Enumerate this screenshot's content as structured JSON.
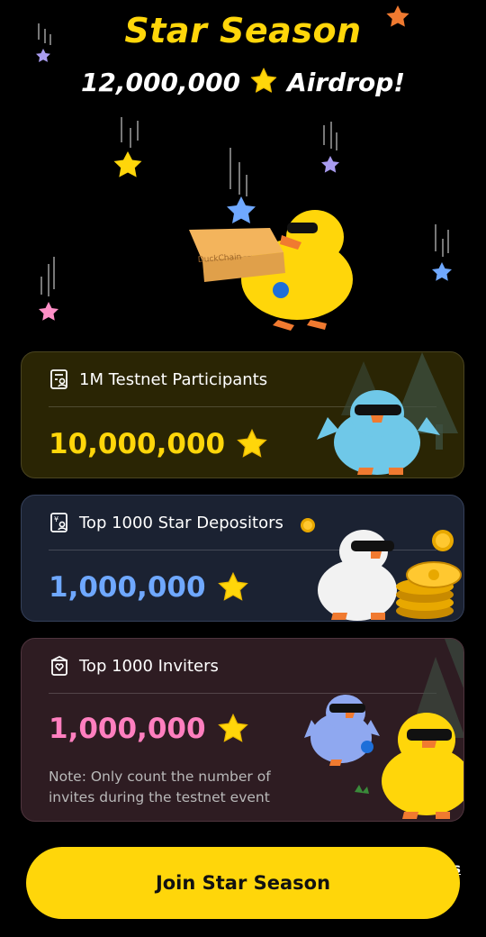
{
  "header": {
    "title": "Star Season",
    "subtitle_amount": "12,000,000",
    "subtitle_suffix": "Airdrop!"
  },
  "hero": {
    "box_label": "DuckChain"
  },
  "cards": [
    {
      "label": "1M Testnet Participants",
      "amount": "10,000,000",
      "amount_color": "#FFD60A",
      "bg": "#2A2504",
      "icon": "id-card-icon"
    },
    {
      "label": "Top 1000 Star Depositors",
      "amount": "1,000,000",
      "amount_color": "#6FA8FF",
      "bg": "#1B2232",
      "icon": "yen-card-icon"
    },
    {
      "label": "Top 1000 Inviters",
      "amount": "1,000,000",
      "amount_color": "#FF7FBF",
      "bg": "#2E1C22",
      "icon": "heart-card-icon",
      "note": "Note: Only count the number of invites during the testnet event"
    }
  ],
  "footer": {
    "join_label": "Join Star Season",
    "side_link": "s"
  },
  "colors": {
    "accent": "#FFD60A",
    "background": "#000000"
  }
}
